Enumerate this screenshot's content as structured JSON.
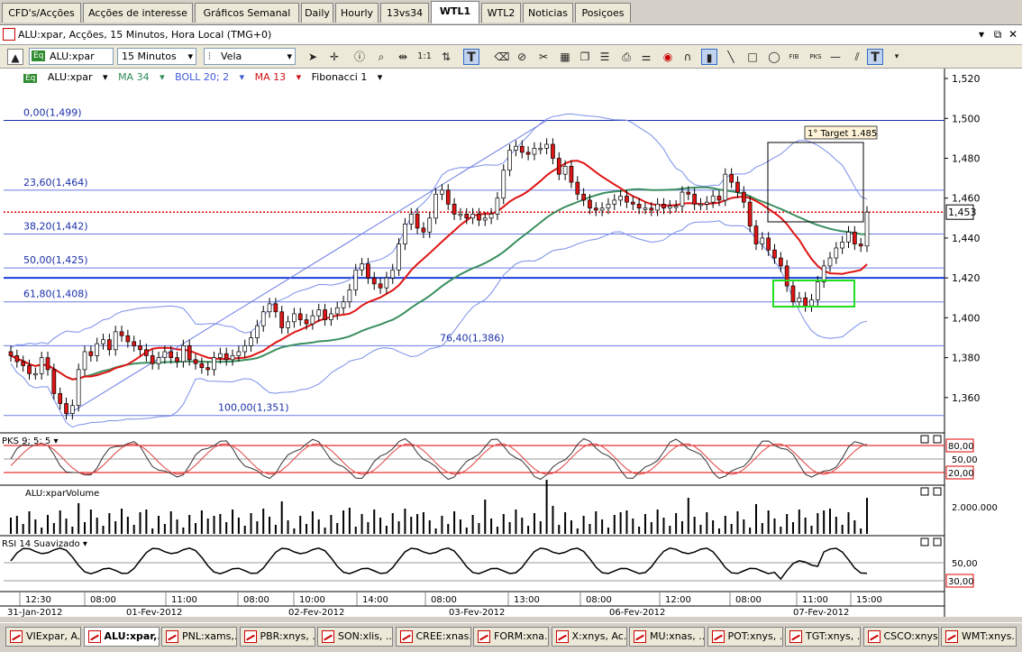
{
  "tabs": [
    {
      "label": "CFD's/Acções",
      "active": false
    },
    {
      "label": "Acções de interesse",
      "active": false
    },
    {
      "label": "Gráficos Semanal",
      "active": false
    },
    {
      "label": "Daily",
      "active": false
    },
    {
      "label": "Hourly",
      "active": false
    },
    {
      "label": "13vs34",
      "active": false
    },
    {
      "label": "WTL1",
      "active": true
    },
    {
      "label": "WTL2",
      "active": false
    },
    {
      "label": "Noticias",
      "active": false
    },
    {
      "label": "Posiçoes",
      "active": false
    }
  ],
  "window": {
    "title": "ALU:xpar, Acções, 15 Minutos, Hora Local (TMG+0)"
  },
  "toolbar": {
    "symbol": "ALU:xpar",
    "interval": "15 Minutos",
    "chart_type": "Vela",
    "symbol_badge": "Eq",
    "scale_label": "1:1"
  },
  "legend": {
    "symbol_badge": "Eq",
    "symbol": "ALU:xpar",
    "ma34": "MA 34",
    "boll": "BOLL 20; 2",
    "ma13": "MA 13",
    "fib": "Fibonacci 1"
  },
  "price_axis": {
    "ticks": [
      "1,520",
      "1,500",
      "1,480",
      "1,460",
      "1,440",
      "1,420",
      "1,400",
      "1,380",
      "1,360"
    ],
    "current": "1,453"
  },
  "fib_levels": [
    {
      "label": "0,00(1,499)",
      "price": 1.499
    },
    {
      "label": "23,60(1,464)",
      "price": 1.464
    },
    {
      "label": "38,20(1,442)",
      "price": 1.442
    },
    {
      "label": "50,00(1,425)",
      "price": 1.425
    },
    {
      "label": "61,80(1,408)",
      "price": 1.408
    },
    {
      "label": "76,40(1,386)",
      "price": 1.386
    },
    {
      "label": "100,00(1,351)",
      "price": 1.351
    }
  ],
  "annotation": {
    "target": "1° Target 1.485"
  },
  "panels": {
    "pks": {
      "label": "PKS 9; 5; 5",
      "upper": "80,00",
      "mid": "50,00",
      "lower": "20,00"
    },
    "volume": {
      "label": "ALU:xparVolume",
      "tick": "2.000.000"
    },
    "rsi": {
      "label": "RSI 14 Suavizado",
      "tick": "50,00",
      "lower": "30,00"
    }
  },
  "time_axis": {
    "times": [
      "12:30",
      "08:00",
      "11:00",
      "08:00",
      "10:00",
      "14:00",
      "08:00",
      "13:00",
      "08:00",
      "12:00",
      "08:00",
      "11:00",
      "15:00"
    ],
    "dates": [
      "31-Jan-2012",
      "01-Fev-2012",
      "02-Fev-2012",
      "03-Fev-2012",
      "06-Fev-2012",
      "07-Fev-2012"
    ]
  },
  "taskbar": [
    {
      "label": "VIExpar, A...",
      "active": false
    },
    {
      "label": "ALU:xpar,...",
      "active": true
    },
    {
      "label": "PNL:xams,...",
      "active": false
    },
    {
      "label": "PBR:xnys, ...",
      "active": false
    },
    {
      "label": "SON:xlis, ...",
      "active": false
    },
    {
      "label": "CREE:xnas...",
      "active": false
    },
    {
      "label": "FORM:xna...",
      "active": false
    },
    {
      "label": "X:xnys, Ac...",
      "active": false
    },
    {
      "label": "MU:xnas, ...",
      "active": false
    },
    {
      "label": "POT:xnys, ...",
      "active": false
    },
    {
      "label": "TGT:xnys, ...",
      "active": false
    },
    {
      "label": "CSCO:xnys...",
      "active": false
    },
    {
      "label": "WMT:xnys...",
      "active": false
    }
  ],
  "chart_data": {
    "type": "candlestick",
    "ylim": [
      1.345,
      1.525
    ],
    "closes": [
      1.381,
      1.378,
      1.376,
      1.372,
      1.372,
      1.38,
      1.374,
      1.362,
      1.357,
      1.352,
      1.356,
      1.374,
      1.383,
      1.381,
      1.387,
      1.389,
      1.384,
      1.393,
      1.391,
      1.388,
      1.386,
      1.384,
      1.381,
      1.377,
      1.38,
      1.383,
      1.38,
      1.378,
      1.386,
      1.379,
      1.377,
      1.375,
      1.374,
      1.38,
      1.382,
      1.379,
      1.381,
      1.383,
      1.386,
      1.39,
      1.396,
      1.403,
      1.407,
      1.403,
      1.395,
      1.398,
      1.402,
      1.399,
      1.397,
      1.401,
      1.404,
      1.399,
      1.402,
      1.405,
      1.408,
      1.414,
      1.424,
      1.427,
      1.42,
      1.417,
      1.415,
      1.42,
      1.424,
      1.437,
      1.447,
      1.452,
      1.445,
      1.443,
      1.45,
      1.462,
      1.464,
      1.457,
      1.452,
      1.452,
      1.45,
      1.452,
      1.449,
      1.45,
      1.452,
      1.46,
      1.474,
      1.484,
      1.486,
      1.483,
      1.482,
      1.485,
      1.485,
      1.487,
      1.48,
      1.472,
      1.476,
      1.468,
      1.462,
      1.459,
      1.455,
      1.454,
      1.455,
      1.457,
      1.459,
      1.461,
      1.458,
      1.457,
      1.455,
      1.455,
      1.454,
      1.457,
      1.455,
      1.456,
      1.456,
      1.463,
      1.462,
      1.457,
      1.457,
      1.458,
      1.461,
      1.459,
      1.472,
      1.468,
      1.463,
      1.458,
      1.446,
      1.437,
      1.44,
      1.434,
      1.43,
      1.426,
      1.416,
      1.408,
      1.41,
      1.406,
      1.409,
      1.418,
      1.426,
      1.43,
      1.435,
      1.438,
      1.443,
      1.437,
      1.436,
      1.453
    ]
  }
}
